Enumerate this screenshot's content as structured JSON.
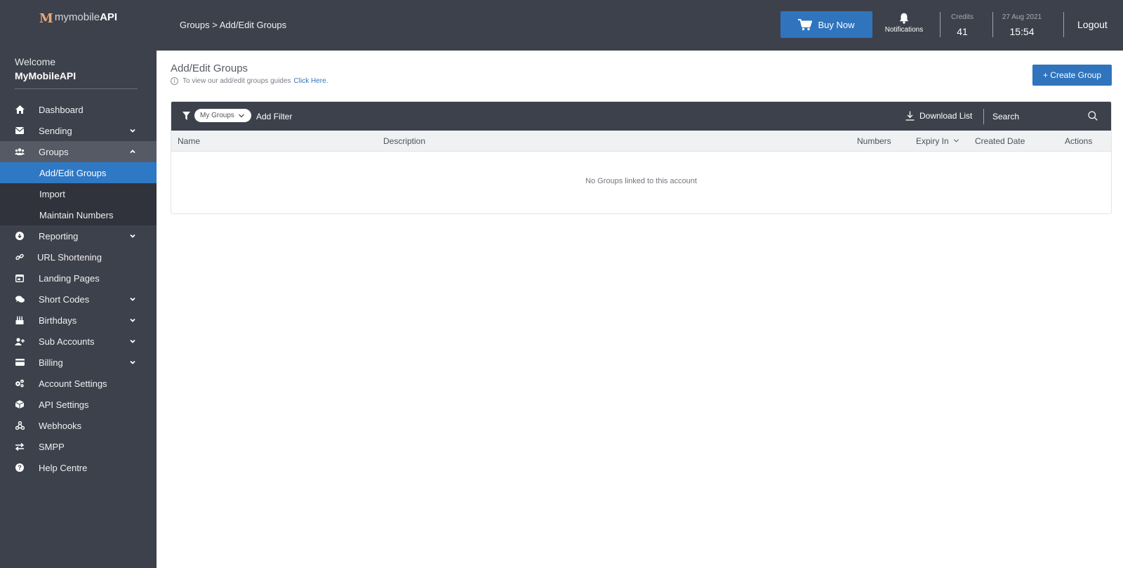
{
  "brand": {
    "mark": "M",
    "name_light": "mymobile",
    "name_bold": "API"
  },
  "welcome": {
    "greeting": "Welcome",
    "user": "MyMobileAPI"
  },
  "sidebar": {
    "items": [
      {
        "label": "Dashboard",
        "icon": "home-icon"
      },
      {
        "label": "Sending",
        "icon": "envelope-icon",
        "expandable": true
      },
      {
        "label": "Groups",
        "icon": "users-icon",
        "expandable": true,
        "open": true,
        "children": [
          {
            "label": "Add/Edit Groups",
            "active": true
          },
          {
            "label": "Import"
          },
          {
            "label": "Maintain Numbers"
          }
        ]
      },
      {
        "label": "Reporting",
        "icon": "download-circle-icon",
        "expandable": true
      },
      {
        "label": "URL Shortening",
        "icon": "link-icon"
      },
      {
        "label": "Landing Pages",
        "icon": "window-icon"
      },
      {
        "label": "Short Codes",
        "icon": "chat-icon",
        "expandable": true
      },
      {
        "label": "Birthdays",
        "icon": "cake-icon",
        "expandable": true
      },
      {
        "label": "Sub Accounts",
        "icon": "user-plus-icon",
        "expandable": true
      },
      {
        "label": "Billing",
        "icon": "credit-card-icon",
        "expandable": true
      },
      {
        "label": "Account Settings",
        "icon": "cogs-icon"
      },
      {
        "label": "API Settings",
        "icon": "cube-icon"
      },
      {
        "label": "Webhooks",
        "icon": "webhook-icon"
      },
      {
        "label": "SMPP",
        "icon": "exchange-icon"
      },
      {
        "label": "Help Centre",
        "icon": "question-circle-icon"
      }
    ]
  },
  "header": {
    "breadcrumb": "Groups > Add/Edit Groups",
    "buy_label": "Buy Now",
    "notifications_label": "Notifications",
    "credits_label": "Credits",
    "credits_value": "41",
    "date": "27 Aug 2021",
    "time": "15:54",
    "logout_label": "Logout"
  },
  "main": {
    "title": "Add/Edit Groups",
    "guide_text": "To view our add/edit groups guides",
    "guide_link": "Click Here.",
    "create_label": "+ Create Group",
    "filter": {
      "chip_label": "My Groups",
      "add_filter_label": "Add Filter",
      "download_label": "Download List",
      "search_label": "Search"
    },
    "table": {
      "columns": [
        "Name",
        "Description",
        "Numbers",
        "Expiry In",
        "Created Date",
        "Actions"
      ],
      "empty_message": "No Groups linked to this account"
    }
  },
  "colors": {
    "sidebar": "#3d414b",
    "accent": "#2f74bd",
    "active_nav": "#2f78c4"
  }
}
